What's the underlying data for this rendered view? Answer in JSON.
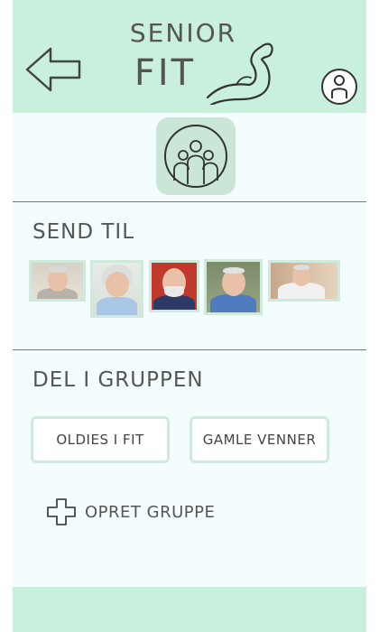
{
  "header": {
    "logo_line1": "SENIOR",
    "logo_line2": "FIT",
    "icons": {
      "back": "arrow-left-icon",
      "logo_mark": "flexed-arm-icon",
      "profile": "user-icon"
    }
  },
  "group": {
    "icon": "group-people-icon"
  },
  "send_to": {
    "title": "SEND TIL",
    "contacts": [
      {
        "photo": "senior-man-glasses"
      },
      {
        "photo": "senior-woman-glasses"
      },
      {
        "photo": "senior-man-beard-glasses"
      },
      {
        "photo": "senior-man-smiling"
      },
      {
        "photo": "senior-man-sofa"
      }
    ]
  },
  "share_group": {
    "title": "DEL I GRUPPEN",
    "groups": [
      {
        "label": "OLDIES I FIT"
      },
      {
        "label": "GAMLE VENNER"
      }
    ],
    "create_label": "OPRET GRUPPE",
    "create_icon": "plus-icon"
  },
  "colors": {
    "header_bg": "#c8f0dc",
    "screen_bg": "#f4fdfe",
    "accent": "#cfe9dc",
    "text": "#555555"
  }
}
